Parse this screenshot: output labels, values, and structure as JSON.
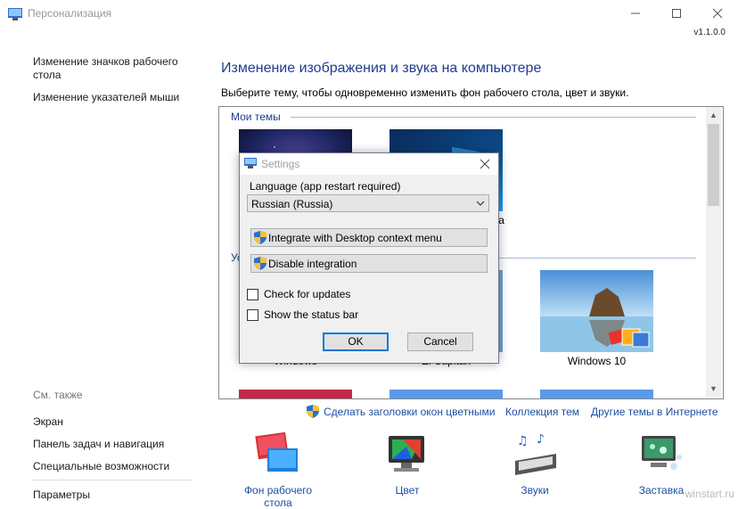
{
  "window": {
    "title": "Персонализация",
    "version": "v1.1.0.0",
    "controls": {
      "minimize": "—",
      "maximize": "☐",
      "close": "✕"
    }
  },
  "sidebar": {
    "links": [
      "Изменение значков рабочего стола",
      "Изменение указателей мыши"
    ],
    "see_also_title": "См. также",
    "see_also": [
      "Экран",
      "Панель задач и навигация",
      "Специальные возможности"
    ],
    "params": "Параметры"
  },
  "main": {
    "heading": "Изменение изображения и звука на компьютере",
    "description": "Выберите тему, чтобы одновременно изменить фон рабочего стола, цвет и звуки.",
    "groups": {
      "my_themes": "Мои темы",
      "installed_partial": "Ус"
    },
    "themes": {
      "my_theme_2_partial": "ма",
      "windows": "Windows",
      "el_capitan": "El Capitan",
      "windows10": "Windows 10"
    },
    "links": [
      "Сделать заголовки окон цветными",
      "Коллекция тем",
      "Другие темы в Интернете"
    ],
    "bottom": [
      "Фон рабочего стола",
      "Цвет",
      "Звуки",
      "Заставка"
    ]
  },
  "dialog": {
    "title": "Settings",
    "language_label": "Language (app restart required)",
    "language_value": "Russian (Russia)",
    "integrate_button": "Integrate with Desktop context menu",
    "disable_button": "Disable integration",
    "check_updates": "Check for updates",
    "show_status_bar": "Show the status bar",
    "ok": "OK",
    "cancel": "Cancel"
  },
  "watermark": "winstart.ru",
  "colors": {
    "heading_blue": "#1e3d8f",
    "link_blue": "#1e4fa3",
    "ok_border": "#0078d7"
  }
}
